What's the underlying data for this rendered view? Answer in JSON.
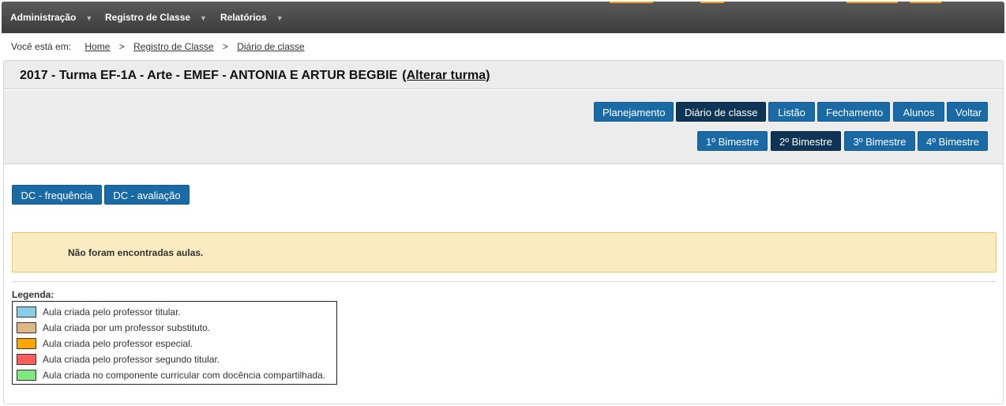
{
  "nav": {
    "items": [
      {
        "label": "Administração"
      },
      {
        "label": "Registro de Classe"
      },
      {
        "label": "Relatórios"
      }
    ],
    "accent_color": "#f0a020"
  },
  "breadcrumb": {
    "lead": "Você está em:",
    "items": [
      "Home",
      "Registro de Classe",
      "Diário de classe"
    ],
    "separator": ">"
  },
  "header": {
    "title": "2017 - Turma EF-1A - Arte - EMEF - ANTONIA E ARTUR BEGBIE",
    "change_link": "(Alterar turma)"
  },
  "toolbar": {
    "primary_buttons": [
      {
        "label": "Planejamento",
        "active": false
      },
      {
        "label": "Diário de classe",
        "active": true
      },
      {
        "label": "Listão",
        "active": false
      },
      {
        "label": "Fechamento",
        "active": false
      },
      {
        "label": "Alunos",
        "active": false
      },
      {
        "label": "Voltar",
        "active": false
      }
    ],
    "bimester_buttons": [
      {
        "label": "1º Bimestre",
        "active": false
      },
      {
        "label": "2º Bimestre",
        "active": true
      },
      {
        "label": "3º Bimestre",
        "active": false
      },
      {
        "label": "4º Bimestre",
        "active": false
      }
    ]
  },
  "dc_tabs": [
    {
      "label": "DC - frequência"
    },
    {
      "label": "DC - avaliação"
    }
  ],
  "alert": {
    "message": "Não foram encontradas aulas."
  },
  "legend": {
    "title": "Legenda:",
    "items": [
      {
        "label": "Aula criada pelo professor titular.",
        "color": "#87ceeb"
      },
      {
        "label": "Aula criada por um professor substituto.",
        "color": "#deb887"
      },
      {
        "label": "Aula criada pelo professor especial.",
        "color": "#ffa500"
      },
      {
        "label": "Aula criada pelo professor segundo titular.",
        "color": "#ff5c5c"
      },
      {
        "label": "Aula criada no componente curricular com docência compartilhada.",
        "color": "#7ee87e"
      }
    ]
  }
}
